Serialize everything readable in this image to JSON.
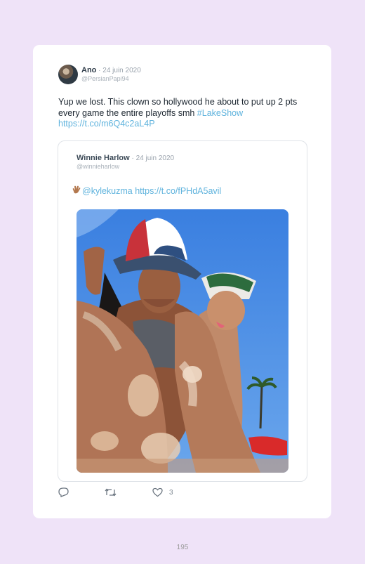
{
  "tweet": {
    "author_name": "Ano",
    "date": "· 24 juin 2020",
    "handle": "@PersianPapi94",
    "text_main": "Yup we lost. This clown so hollywood he about to put up 2 pts every game the entire playoffs smh ",
    "hashtag": "#LakeShow",
    "link": "https://t.co/m6Q4c2aL4P",
    "like_count": "3"
  },
  "quoted": {
    "author_name": "Winnie Harlow",
    "date": "· 24 juin 2020",
    "handle": "@winnieharlow",
    "mention": "@kylekuzma",
    "link": "https://t.co/fPHdA5avil"
  },
  "page_number": "195",
  "colors": {
    "background": "#efe3f8",
    "link": "#5fb3dd",
    "card": "#ffffff"
  },
  "icons": [
    "reply-icon",
    "retweet-icon",
    "like-icon",
    "clap-emoji-icon"
  ]
}
